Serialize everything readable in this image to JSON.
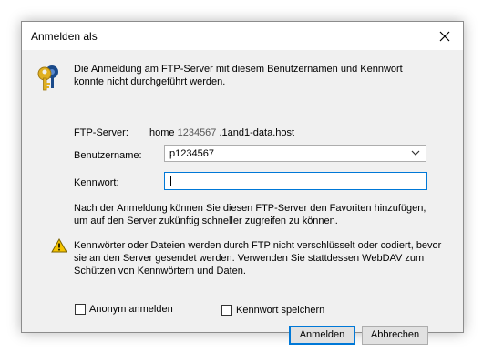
{
  "window": {
    "title": "Anmelden als"
  },
  "message": "Die Anmeldung am FTP-Server mit diesem Benutzernamen und Kennwort konnte nicht durchgeführt werden.",
  "server": {
    "label": "FTP-Server:",
    "prefix": "home",
    "id": "1234567",
    "suffix": ".1and1-data.host"
  },
  "username": {
    "label": "Benutzername:",
    "value": "p1234567"
  },
  "password": {
    "label": "Kennwort:",
    "value": ""
  },
  "info": "Nach der Anmeldung können Sie diesen FTP-Server den Favoriten hinzufügen, um auf den Server zukünftig schneller zugreifen zu können.",
  "warning": "Kennwörter oder Dateien werden durch FTP nicht verschlüsselt oder codiert, bevor sie an den Server gesendet werden. Verwenden Sie stattdessen WebDAV zum Schützen von Kennwörtern und Daten.",
  "checkboxes": {
    "anonymous": {
      "label": "Anonym anmelden",
      "checked": false
    },
    "save_password": {
      "label": "Kennwort speichern",
      "checked": false
    }
  },
  "buttons": {
    "login": "Anmelden",
    "cancel": "Abbrechen"
  },
  "colors": {
    "accent": "#0078d7",
    "dialog_bg": "#f0f0f0",
    "warning_yellow": "#f5c400"
  }
}
